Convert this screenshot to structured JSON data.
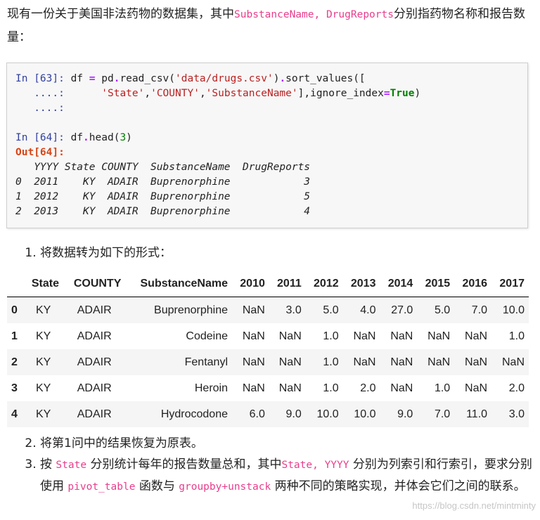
{
  "intro": {
    "text_before": "现有一份关于美国非法药物的数据集，其中",
    "code": "SubstanceName, DrugReports",
    "text_after": "分别指药物名称和报告数量："
  },
  "code_cell": {
    "in63": "In [63]:",
    "cont": "....:",
    "in64": "In [64]:",
    "out64": "Out[64]:",
    "df_header": "   YYYY State COUNTY  SubstanceName  DrugReports",
    "df_rows": [
      "0  2011    KY  ADAIR  Buprenorphine            3",
      "1  2012    KY  ADAIR  Buprenorphine            5",
      "2  2013    KY  ADAIR  Buprenorphine            4"
    ]
  },
  "q1": "将数据转为如下的形式：",
  "table": {
    "columns": [
      "",
      "State",
      "COUNTY",
      "SubstanceName",
      "2010",
      "2011",
      "2012",
      "2013",
      "2014",
      "2015",
      "2016",
      "2017"
    ],
    "rows": [
      [
        "0",
        "KY",
        "ADAIR",
        "Buprenorphine",
        "NaN",
        "3.0",
        "5.0",
        "4.0",
        "27.0",
        "5.0",
        "7.0",
        "10.0"
      ],
      [
        "1",
        "KY",
        "ADAIR",
        "Codeine",
        "NaN",
        "NaN",
        "1.0",
        "NaN",
        "NaN",
        "NaN",
        "NaN",
        "1.0"
      ],
      [
        "2",
        "KY",
        "ADAIR",
        "Fentanyl",
        "NaN",
        "NaN",
        "1.0",
        "NaN",
        "NaN",
        "NaN",
        "NaN",
        "NaN"
      ],
      [
        "3",
        "KY",
        "ADAIR",
        "Heroin",
        "NaN",
        "NaN",
        "1.0",
        "2.0",
        "NaN",
        "1.0",
        "NaN",
        "2.0"
      ],
      [
        "4",
        "KY",
        "ADAIR",
        "Hydrocodone",
        "6.0",
        "9.0",
        "10.0",
        "10.0",
        "9.0",
        "7.0",
        "11.0",
        "3.0"
      ]
    ]
  },
  "q2": "将第1问中的结果恢复为原表。",
  "q3": {
    "t1": "按",
    "c1": "State",
    "t2": "分别统计每年的报告数量总和，其中",
    "c2": "State, YYYY",
    "t3": "分别为列索引和行索引，要求分别使用",
    "c3": "pivot_table",
    "t4": "函数与",
    "c4": "groupby+unstack",
    "t5": "两种不同的策略实现，并体会它们之间的联系。"
  },
  "watermark": "https://blog.csdn.net/mintminty"
}
